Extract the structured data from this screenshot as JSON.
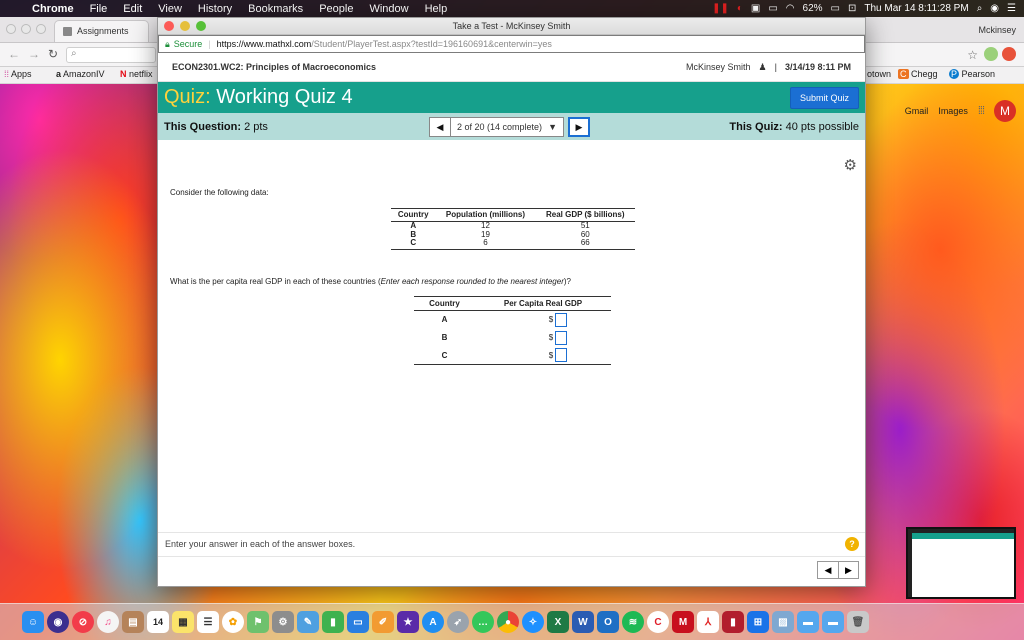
{
  "menubar": {
    "apple": "",
    "app": "Chrome",
    "items": [
      "File",
      "Edit",
      "View",
      "History",
      "Bookmarks",
      "People",
      "Window",
      "Help"
    ],
    "battery": "62%",
    "clock": "Thu Mar 14  8:11:28 PM"
  },
  "bg_window": {
    "tab_label": "Assignments",
    "profile": "Mckinsey",
    "bookmarks": [
      {
        "label": "Apps"
      },
      {
        "label": "AmazonIV"
      },
      {
        "label": "netflix"
      },
      {
        "label": "otown"
      },
      {
        "label": "Chegg"
      },
      {
        "label": "Pearson"
      }
    ],
    "google_links": {
      "gmail": "Gmail",
      "images": "Images",
      "avatar": "M"
    }
  },
  "window": {
    "title": "Take a Test - McKinsey Smith",
    "secure_label": "Secure",
    "url_main": "https://www.mathxl.com",
    "url_rest": "/Student/PlayerTest.aspx?testId=196160691&centerwin=yes"
  },
  "course": {
    "name": "ECON2301.WC2: Principles of Macroeconomics",
    "user": "McKinsey Smith",
    "sep": "|",
    "datetime": "3/14/19 8:11 PM"
  },
  "quiz": {
    "prefix": "Quiz:",
    "title": "Working Quiz 4",
    "submit_label": "Submit Quiz"
  },
  "question_bar": {
    "this_question_label": "This Question:",
    "this_question_value": "2 pts",
    "position": "2 of 20 (14 complete)",
    "this_quiz_label": "This Quiz:",
    "this_quiz_value": "40 pts possible"
  },
  "question": {
    "prompt": "Consider the following data:",
    "data_table": {
      "headers": [
        "Country",
        "Population (millions)",
        "Real GDP ($ billions)"
      ],
      "rows": [
        {
          "country": "A",
          "population": "12",
          "gdp": "51"
        },
        {
          "country": "B",
          "population": "19",
          "gdp": "60"
        },
        {
          "country": "C",
          "population": "6",
          "gdp": "66"
        }
      ]
    },
    "ask_main": "What is the per capita real GDP in each of these countries (",
    "ask_italic": "Enter each response rounded to the nearest integer",
    "ask_end": ")?",
    "answer_table": {
      "headers": [
        "Country",
        "Per Capita Real GDP"
      ],
      "rows": [
        {
          "country": "A",
          "currency": "$",
          "value": ""
        },
        {
          "country": "B",
          "currency": "$",
          "value": ""
        },
        {
          "country": "C",
          "currency": "$",
          "value": ""
        }
      ]
    }
  },
  "footer": {
    "note": "Enter your answer in each of the answer boxes.",
    "help": "?"
  },
  "dock": {
    "calendar_day": "14"
  }
}
